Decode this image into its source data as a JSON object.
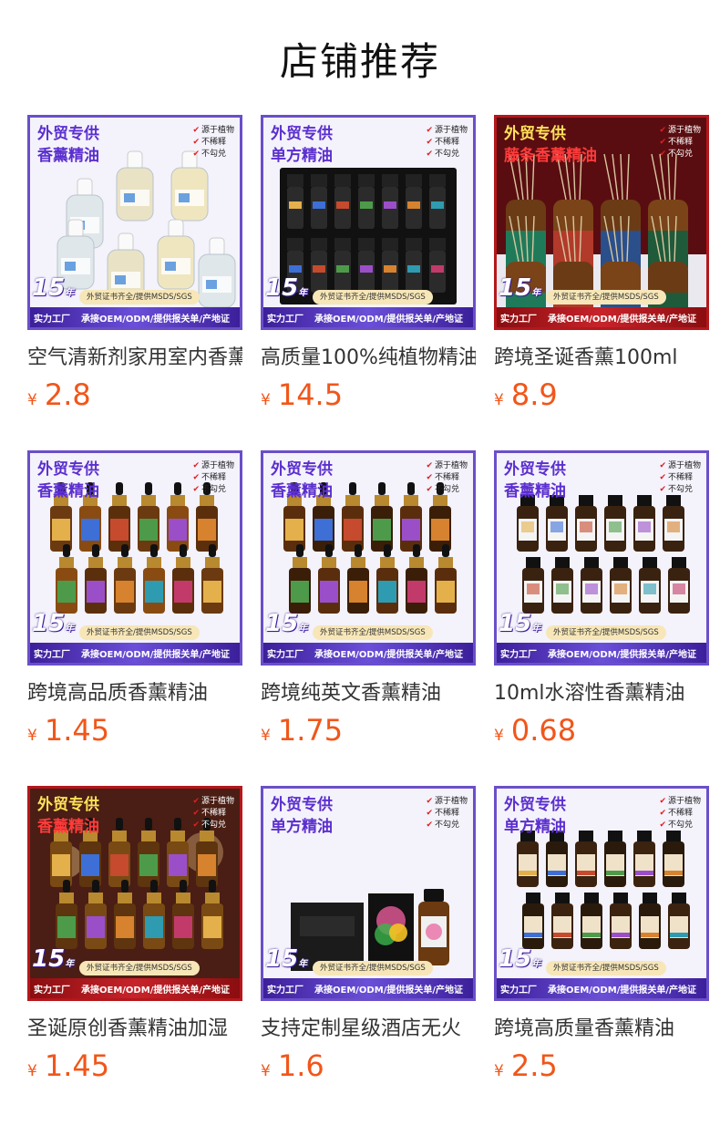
{
  "page": {
    "title": "店铺推荐"
  },
  "badge": {
    "years": "15",
    "years_unit": "年",
    "factory": "实力工厂",
    "cert": "外贸证书齐全/提供MSDS/SGS",
    "oem": "承接OEM/ODM/提供报关单/产地证",
    "checks": [
      "源于植物",
      "不稀释",
      "不勾兑"
    ]
  },
  "currency": "¥",
  "colors": {
    "accent_purple": "#6a4fc9",
    "accent_red": "#b5171c",
    "price": "#f1561a"
  },
  "products": [
    {
      "tag1": "外贸专供",
      "tag2": "香薰精油",
      "theme": "purple",
      "art": "refill",
      "name": "空气清新剂家用室内香薰",
      "price": "2.8"
    },
    {
      "tag1": "外贸专供",
      "tag2": "单方精油",
      "theme": "purple",
      "art": "boxset",
      "name": "高质量100%纯植物精油",
      "price": "14.5"
    },
    {
      "tag1": "外贸专供",
      "tag2": "藤条香薰精油",
      "theme": "red",
      "art": "reed",
      "name": "跨境圣诞香薰100ml",
      "price": "8.9"
    },
    {
      "tag1": "外贸专供",
      "tag2": "香薰精油",
      "theme": "purple",
      "art": "dropper-color",
      "name": "跨境高品质香薰精油",
      "price": "1.45"
    },
    {
      "tag1": "外贸专供",
      "tag2": "香薰精油",
      "theme": "purple",
      "art": "dropper-dark",
      "name": "跨境纯英文香薰精油",
      "price": "1.75"
    },
    {
      "tag1": "外贸专供",
      "tag2": "香薰精油",
      "theme": "purple",
      "art": "white-label",
      "name": "10ml水溶性香薰精油",
      "price": "0.68"
    },
    {
      "tag1": "外贸专供",
      "tag2": "香薰精油",
      "theme": "red",
      "art": "xmas-dropper",
      "name": "圣诞原创香薰精油加湿",
      "price": "1.45"
    },
    {
      "tag1": "外贸专供",
      "tag2": "单方精油",
      "theme": "purple",
      "art": "aroma-box",
      "name": "支持定制星级酒店无火",
      "price": "1.6"
    },
    {
      "tag1": "外贸专供",
      "tag2": "单方精油",
      "theme": "purple",
      "art": "rijiy",
      "name": "跨境高质量香薰精油",
      "price": "2.5"
    }
  ]
}
